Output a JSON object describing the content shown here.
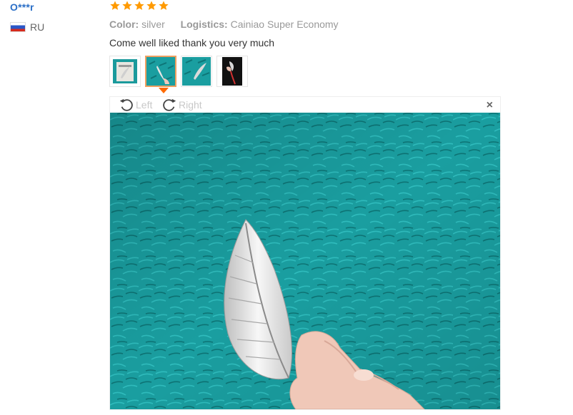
{
  "reviewer": {
    "name": "O***r",
    "country_code": "RU",
    "rating": 5
  },
  "review": {
    "color_label": "Color:",
    "color_value": "silver",
    "logistics_label": "Logistics:",
    "logistics_value": "Cainiao Super Economy",
    "text": "Come well liked thank you very much"
  },
  "thumbnails": [
    {
      "name": "thumb-feather-on-paper",
      "selected": false
    },
    {
      "name": "thumb-feather-on-teal-rug",
      "selected": true
    },
    {
      "name": "thumb-feather-close-up",
      "selected": false
    },
    {
      "name": "thumb-feather-held-dark",
      "selected": false
    }
  ],
  "viewer": {
    "rotate_left_label": "Left",
    "rotate_right_label": "Right",
    "close_symbol": "×"
  },
  "colors": {
    "star": "#ff9a00",
    "username": "#2b6fc7",
    "selected_border": "#f0a060",
    "rug": "#1a9ea0"
  }
}
